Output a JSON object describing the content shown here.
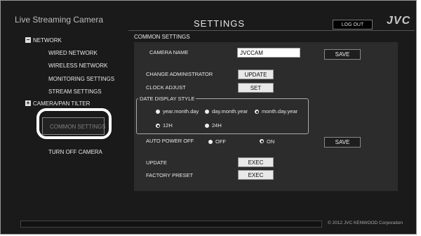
{
  "header": {
    "app_title": "Live Streaming Camera",
    "page_title": "SETTINGS",
    "logout_label": "LOG OUT",
    "brand": "JVC"
  },
  "sidebar": {
    "network": {
      "icon": "collapse-minus-icon",
      "label": "NETWORK"
    },
    "network_items": [
      "WIRED NETWORK",
      "WIRELESS NETWORK",
      "MONITORING SETTINGS",
      "STREAM SETTINGS"
    ],
    "camera": {
      "icon": "expand-plus-icon",
      "label": "CAMERA/PAN TILTER"
    },
    "common_settings": "COMMON SETTINGS",
    "turn_off": "TURN OFF CAMERA"
  },
  "content": {
    "section_title": "COMMON SETTINGS",
    "camera_name": {
      "label": "CAMERA NAME",
      "value": "JVCCAM",
      "save": "SAVE"
    },
    "change_admin": {
      "label": "CHANGE ADMINISTRATOR",
      "button": "UPDATE"
    },
    "clock_adjust": {
      "label": "CLOCK ADJUST",
      "button": "SET"
    },
    "date_display": {
      "legend": "DATE DISPLAY STYLE",
      "formats": [
        "year.month.day",
        "day.month.year",
        "month.day.year"
      ],
      "selected_format": "month.day.year",
      "hours": [
        "12H",
        "24H"
      ],
      "selected_hour": "12H"
    },
    "auto_power_off": {
      "label": "AUTO POWER OFF",
      "off": "OFF",
      "on": "ON",
      "selected": "ON",
      "save": "SAVE"
    },
    "update": {
      "label": "UPDATE",
      "button": "EXEC"
    },
    "factory_preset": {
      "label": "FACTORY PRESET",
      "button": "EXEC"
    }
  },
  "footer": {
    "copyright": "© 2012 JVC KENWOOD Corporation"
  },
  "colors": {
    "background": "#1a1a1a",
    "panel": "#2c2c2c",
    "highlight_ring": "#ffffff"
  }
}
